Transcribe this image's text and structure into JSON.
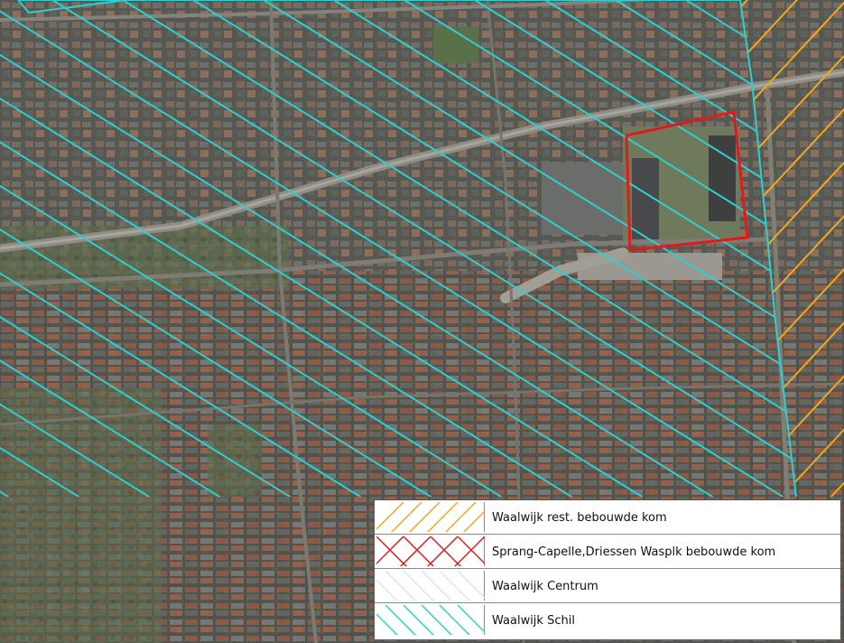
{
  "map": {
    "basemap": "aerial-photo",
    "highlight_color": "#e01a1a"
  },
  "legend": {
    "items": [
      {
        "label": "Waalwijk rest. bebouwde kom",
        "color": "#f0a820",
        "pattern": "diagonal-up"
      },
      {
        "label": "Sprang-Capelle,Driessen Wasplk bebouwde kom",
        "color": "#d42020",
        "pattern": "diagonal-up-down"
      },
      {
        "label": "Waalwijk Centrum",
        "color": "#e4e4e4",
        "pattern": "diagonal-down"
      },
      {
        "label": "Waalwijk Schil",
        "color": "#2ecfd0",
        "pattern": "diagonal-down"
      }
    ]
  }
}
